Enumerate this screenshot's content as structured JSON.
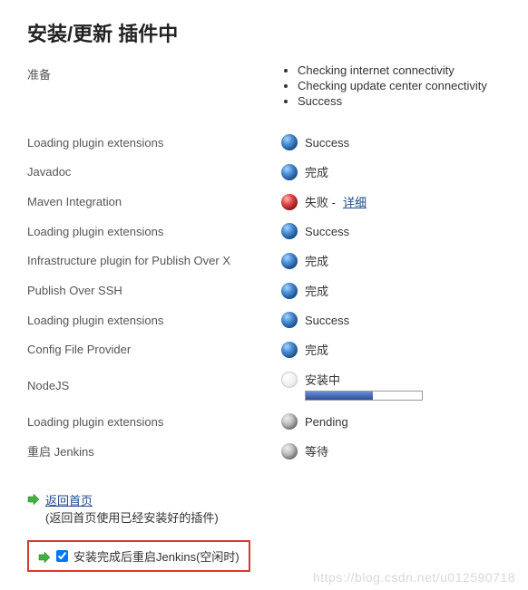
{
  "title": "安装/更新 插件中",
  "prep": {
    "label": "准备",
    "items": [
      "Checking internet connectivity",
      "Checking update center connectivity",
      "Success"
    ]
  },
  "rows": [
    {
      "name": "Loading plugin extensions",
      "icon": "blue",
      "status": "Success"
    },
    {
      "name": "Javadoc",
      "icon": "blue",
      "status": "完成"
    },
    {
      "name": "Maven Integration",
      "icon": "red",
      "status": "失败 -",
      "detail": "详细"
    },
    {
      "name": "Loading plugin extensions",
      "icon": "blue",
      "status": "Success"
    },
    {
      "name": "Infrastructure plugin for Publish Over X",
      "icon": "blue",
      "status": "完成"
    },
    {
      "name": "Publish Over SSH",
      "icon": "blue",
      "status": "完成"
    },
    {
      "name": "Loading plugin extensions",
      "icon": "blue",
      "status": "Success"
    },
    {
      "name": "Config File Provider",
      "icon": "blue",
      "status": "完成"
    },
    {
      "name": "NodeJS",
      "icon": "white",
      "status": "安装中",
      "progress": 58
    },
    {
      "name": "Loading plugin extensions",
      "icon": "grey",
      "status": "Pending"
    },
    {
      "name": "重启 Jenkins",
      "icon": "grey",
      "status": "等待"
    }
  ],
  "back": {
    "link": "返回首页",
    "note": "(返回首页使用已经安装好的插件)"
  },
  "restart": {
    "label": "安装完成后重启Jenkins(空闲时)",
    "checked": true
  },
  "watermark": "https://blog.csdn.net/u012590718"
}
